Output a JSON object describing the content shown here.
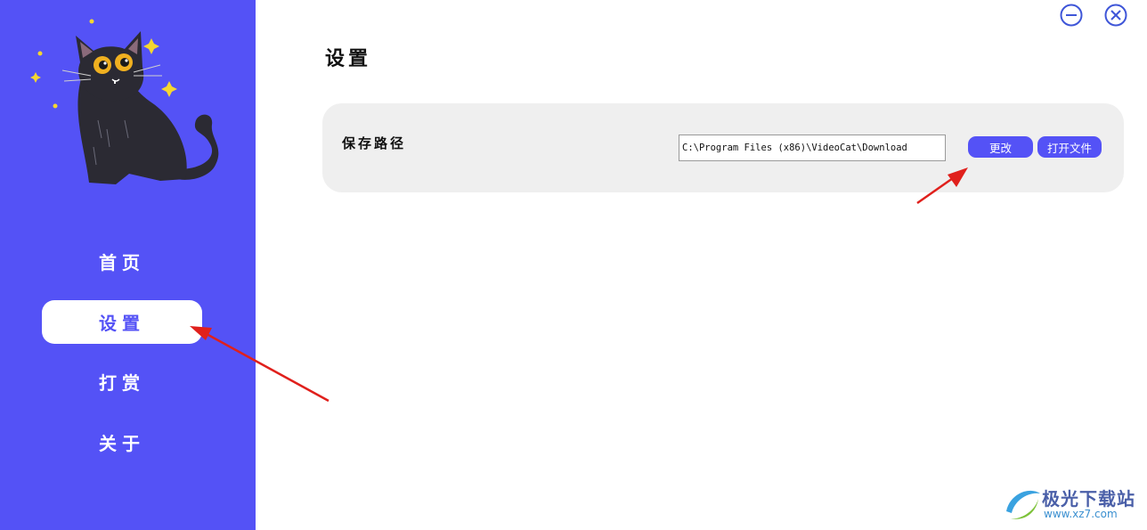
{
  "sidebar": {
    "items": [
      {
        "label": "首页",
        "active": false
      },
      {
        "label": "设置",
        "active": true
      },
      {
        "label": "打赏",
        "active": false
      },
      {
        "label": "关于",
        "active": false
      }
    ]
  },
  "window_controls": {
    "minimize_icon": "minimize-circle-icon",
    "close_icon": "close-circle-icon"
  },
  "main": {
    "title": "设置",
    "save_path": {
      "label": "保存路径",
      "value": "C:\\Program Files (x86)\\VideoCat\\Download",
      "change_button": "更改",
      "open_button": "打开文件"
    }
  },
  "watermark": {
    "name": "极光下载站",
    "url": "www.xz7.com"
  },
  "colors": {
    "accent": "#5452f6",
    "card": "#efefef",
    "annotation": "#e0201c"
  }
}
